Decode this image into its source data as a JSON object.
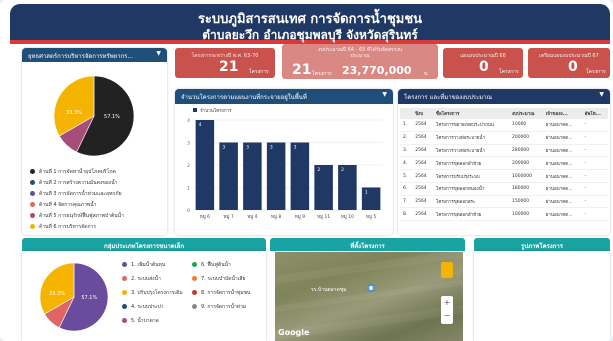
{
  "header": {
    "title": "ระบบภูมิสารสนเทศ การจัดการน้ำชุมชน",
    "subtitle": "ตำบลยะวึก อำเภอชุมพลบุรี จังหวัดสุรินทร์"
  },
  "strategy_card": {
    "title": "ยุทธศาสตร์การบริหารจัดการทรัพยากร...",
    "pie": [
      {
        "label": "ด้านที่ 1 การจัดหาน้ำอุปโภคบริโภค",
        "value": 57.1,
        "color": "#222222"
      },
      {
        "label": "ด้านที่ 2 การสร้างความมั่นคงของน้ำ",
        "value": 0,
        "color": "#1f4e79"
      },
      {
        "label": "ด้านที่ 3 การจัดการน้ำท่วมและอุทกภัย",
        "value": 0,
        "color": "#6a4c9c"
      },
      {
        "label": "ด้านที่ 4 จัดการคุณภาพน้ำ",
        "value": 0,
        "color": "#e06666"
      },
      {
        "label": "ด้านที่ 5 การอนุรักษ์ฟื้นฟูสภาพป่าต้นน้ำ",
        "value": 9.5,
        "color": "#a64d79"
      },
      {
        "label": "ด้านที่ 6 การบริหารจัดการ",
        "value": 33.3,
        "color": "#f4b400"
      }
    ],
    "pie_label_big": "57.1%",
    "pie_label_small": "33.3%"
  },
  "stats": [
    {
      "label": "โครงการระหว่างปี พ.ศ. 63-70",
      "value": "21",
      "unit": "โครงการ",
      "color": "#c9524d"
    },
    {
      "label": "งบประมาณปี 64 - 65 ที่ได้รับจัดสรรงบประมาณ",
      "value": "21",
      "unit": "โครงการ",
      "amount": "23,770,000",
      "amount_unit": "บ.",
      "color": "#d98883"
    },
    {
      "label": "แผนงบประมาณปี 66",
      "value": "0",
      "unit": "โครงการ",
      "color": "#c9524d"
    },
    {
      "label": "เตรียมแผนงบประมาณปี 67",
      "value": "0",
      "unit": "โครงการ",
      "color": "#c9524d"
    }
  ],
  "bar_card": {
    "title": "จำนวนโครงการตามแผนงานที่กระจายอยู่ในพื้นที่",
    "legend": "จำนวนโครงการ",
    "chart_data": {
      "type": "bar",
      "categories": [
        "หมู่ 6",
        "หมู่ 7",
        "หมู่ 4",
        "หมู่ 8",
        "หมู่ 9",
        "หมู่ 11",
        "หมู่ 10",
        "หมู่ 5"
      ],
      "values": [
        4,
        3,
        3,
        3,
        3,
        2,
        2,
        1
      ],
      "ylim": [
        0,
        4
      ]
    }
  },
  "table_card": {
    "title": "โครงการ และที่มาของงบประมาณ",
    "columns": [
      "ปีงบ",
      "ชื่อโครงการ",
      "งบประมาณ",
      "เจ้าของง...",
      "อัพโห..."
    ],
    "rows": [
      [
        "1.",
        "2564",
        "โครงการขยายเขตประปาถนน",
        "10000",
        "ผ่านอนาคต..."
      ],
      [
        "2.",
        "2564",
        "โครงการวางท่อระบายน้ำ",
        "200000",
        "ผ่านอนาคต..."
      ],
      [
        "3.",
        "2564",
        "โครงการวางท่อระบายน้ำ",
        "280000",
        "ผ่านอนาคต..."
      ],
      [
        "4.",
        "2564",
        "โครงการขุดลอกลำห้วย",
        "200000",
        "ผ่านอนาคต..."
      ],
      [
        "5.",
        "2564",
        "โครงการปรับปรุงระบบ",
        "1000000",
        "ผ่านอนาคต..."
      ],
      [
        "6.",
        "2564",
        "โครงการขุดลอกหนองน้ำ",
        "180000",
        "ผ่านอนาคต..."
      ],
      [
        "7.",
        "2564",
        "โครงการขุดลอกสระ",
        "150000",
        "ผ่านอนาคต..."
      ],
      [
        "8.",
        "2564",
        "โครงการขุดลอกลำห้วย",
        "100000",
        "ผ่านอนาคต..."
      ]
    ]
  },
  "group_card": {
    "title": "กลุ่มประเภทโครงการขนาดเล็ก",
    "pie": [
      {
        "label": "1. เพิ่มน้ำต้นทุน",
        "value": 57.1,
        "color": "#6a4c9c"
      },
      {
        "label": "2. ระบบส่งน้ำ",
        "value": 9.5,
        "color": "#e06666"
      },
      {
        "label": "3. ปรับปรุงโครงการเดิม",
        "value": 33.3,
        "color": "#f4b400"
      },
      {
        "label": "4. ระบบประปา",
        "value": 0,
        "color": "#1f4e79"
      },
      {
        "label": "5. น้ำบาดาล",
        "value": 0,
        "color": "#a64d79"
      },
      {
        "label": "6. ฟื้นฟูต้นน้ำ",
        "value": 0,
        "color": "#1aa35a"
      },
      {
        "label": "7. ระบบบำบัดน้ำเสีย",
        "value": 0,
        "color": "#f07d2a"
      },
      {
        "label": "8. การจัดการน้ำชุมชน",
        "value": 0,
        "color": "#c0392b"
      },
      {
        "label": "9. การจัดการน้ำท่วม",
        "value": 0,
        "color": "#888888"
      }
    ],
    "pie_label_big": "57.1%",
    "pie_label_small": "33.3%"
  },
  "location_card": {
    "title": "ที่ตั้งโครงการ",
    "marker_label": "รร.บ้านตลาดชุม",
    "google": "Google"
  },
  "photo_card": {
    "title": "รูปภาพโครงการ"
  }
}
